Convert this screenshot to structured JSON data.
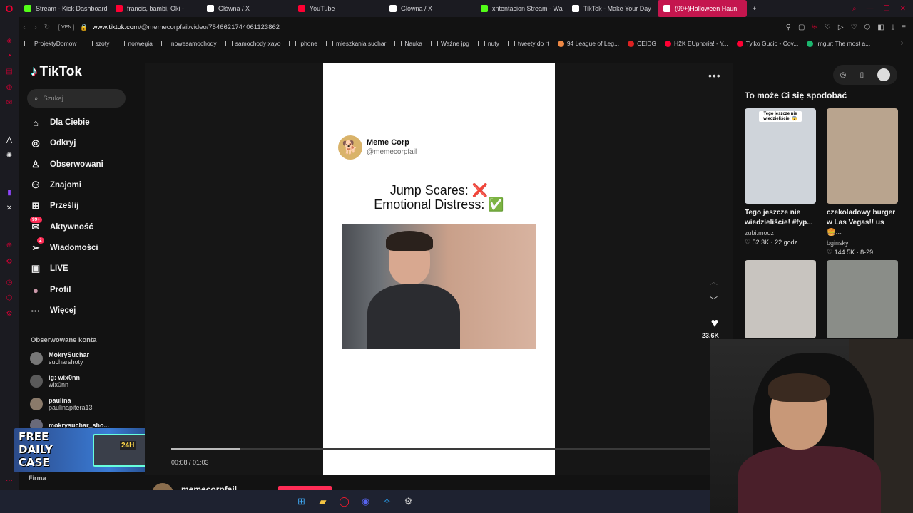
{
  "browser": {
    "tabs": [
      {
        "title": "Stream - Kick Dashboard",
        "color": "#53fc18"
      },
      {
        "title": "francis, bambi, Oki -",
        "color": "#ff0033"
      },
      {
        "title": "Główna / X",
        "color": "#ffffff"
      },
      {
        "title": "YouTube",
        "color": "#ff0033"
      },
      {
        "title": "Główna / X",
        "color": "#ffffff"
      },
      {
        "title": "xntentacion Stream - Wa",
        "color": "#53fc18"
      },
      {
        "title": "TikTok - Make Your Day",
        "color": "#ffffff"
      },
      {
        "title": "(99+)Halloween Haun",
        "color": "#ffffff",
        "active": true
      }
    ],
    "vpn_label": "VPN",
    "url_base": "www.tiktok.com",
    "url_path": "/@memecorpfail/video/7546621744061123862",
    "bookmarks": [
      {
        "label": "ProjektyDomow",
        "kind": "folder"
      },
      {
        "label": "szoty",
        "kind": "folder"
      },
      {
        "label": "norwegia",
        "kind": "folder"
      },
      {
        "label": "nowesamochody",
        "kind": "folder"
      },
      {
        "label": "samochody xayo",
        "kind": "folder"
      },
      {
        "label": "iphone",
        "kind": "folder"
      },
      {
        "label": "mieszkania suchar",
        "kind": "folder"
      },
      {
        "label": "Nauka",
        "kind": "folder"
      },
      {
        "label": "Ważne jpg",
        "kind": "folder"
      },
      {
        "label": "nuty",
        "kind": "folder"
      },
      {
        "label": "tweety do rt",
        "kind": "folder"
      },
      {
        "label": "94 League of Leg...",
        "kind": "site",
        "color": "#e84"
      },
      {
        "label": "CEIDG",
        "kind": "site",
        "color": "#d22"
      },
      {
        "label": "H2K EUphoria! - Y...",
        "kind": "site",
        "color": "#f03"
      },
      {
        "label": "Tylko Gucio - Cov...",
        "kind": "site",
        "color": "#f03"
      },
      {
        "label": "Imgur: The most a...",
        "kind": "site",
        "color": "#1bb76e"
      }
    ]
  },
  "tiktok": {
    "logo": "TikTok",
    "search_placeholder": "Szukaj",
    "nav": [
      {
        "label": "Dla Ciebie",
        "icon": "home-icon",
        "glyph": "⌂"
      },
      {
        "label": "Odkryj",
        "icon": "compass-icon",
        "glyph": "◎"
      },
      {
        "label": "Obserwowani",
        "icon": "following-icon",
        "glyph": "♙"
      },
      {
        "label": "Znajomi",
        "icon": "friends-icon",
        "glyph": "⚇"
      },
      {
        "label": "Prześlij",
        "icon": "upload-icon",
        "glyph": "⊞"
      },
      {
        "label": "Aktywność",
        "icon": "activity-icon",
        "glyph": "✉",
        "badge": "99+"
      },
      {
        "label": "Wiadomości",
        "icon": "messages-icon",
        "glyph": "➢",
        "badge": "2"
      },
      {
        "label": "LIVE",
        "icon": "live-icon",
        "glyph": "▣"
      },
      {
        "label": "Profil",
        "icon": "profile-icon",
        "glyph": "●"
      },
      {
        "label": "Więcej",
        "icon": "more-icon",
        "glyph": "···"
      }
    ],
    "followed_title": "Obserwowane konta",
    "followed": [
      {
        "name": "MokrySuchar",
        "handle": "sucharshoty"
      },
      {
        "name": "ig: wix0nn",
        "handle": "wix0nn"
      },
      {
        "name": "paulina",
        "handle": "paulinapitera13"
      },
      {
        "name": "mokrysuchar_sho...",
        "handle": ""
      }
    ],
    "footer_label": "Firma",
    "promo_line1": "FREE",
    "promo_line2": "DAILY",
    "promo_line3": "CASE",
    "promo_badge": "24H",
    "video": {
      "author_name": "Meme Corp",
      "author_handle": "@memecorpfail",
      "line1": "Jump Scares: ❌",
      "line2": "Emotional Distress: ✅",
      "time": "00:08 / 01:03",
      "progress": 0.127,
      "likes": "23.6K",
      "author_bar_name": "memecorpfail"
    },
    "recommendations_title": "To może Ci się spodobać",
    "recommendations": [
      {
        "caption": "Tego jeszcze nie wiedzieliście! #fyp...",
        "author": "zubi.mooz",
        "likes": "52.3K",
        "age": "22 godz....",
        "thumb_text": "Tego jeszcze nie wiedzieliście! 😱",
        "thumb_color": "#cfd4da"
      },
      {
        "caption": "czekoladowy burger w Las Vegas!! us🍔...",
        "author": "bginsky",
        "likes": "144.5K",
        "age": "8-29",
        "thumb_text": "",
        "thumb_color": "#b9a48e"
      },
      {
        "caption": "",
        "author": "",
        "likes": "",
        "age": "",
        "thumb_text": "",
        "thumb_color": "#c8c4bf"
      },
      {
        "caption": "",
        "author": "",
        "likes": "",
        "age": "",
        "thumb_text": "",
        "thumb_color": "#8a8d88"
      }
    ]
  }
}
